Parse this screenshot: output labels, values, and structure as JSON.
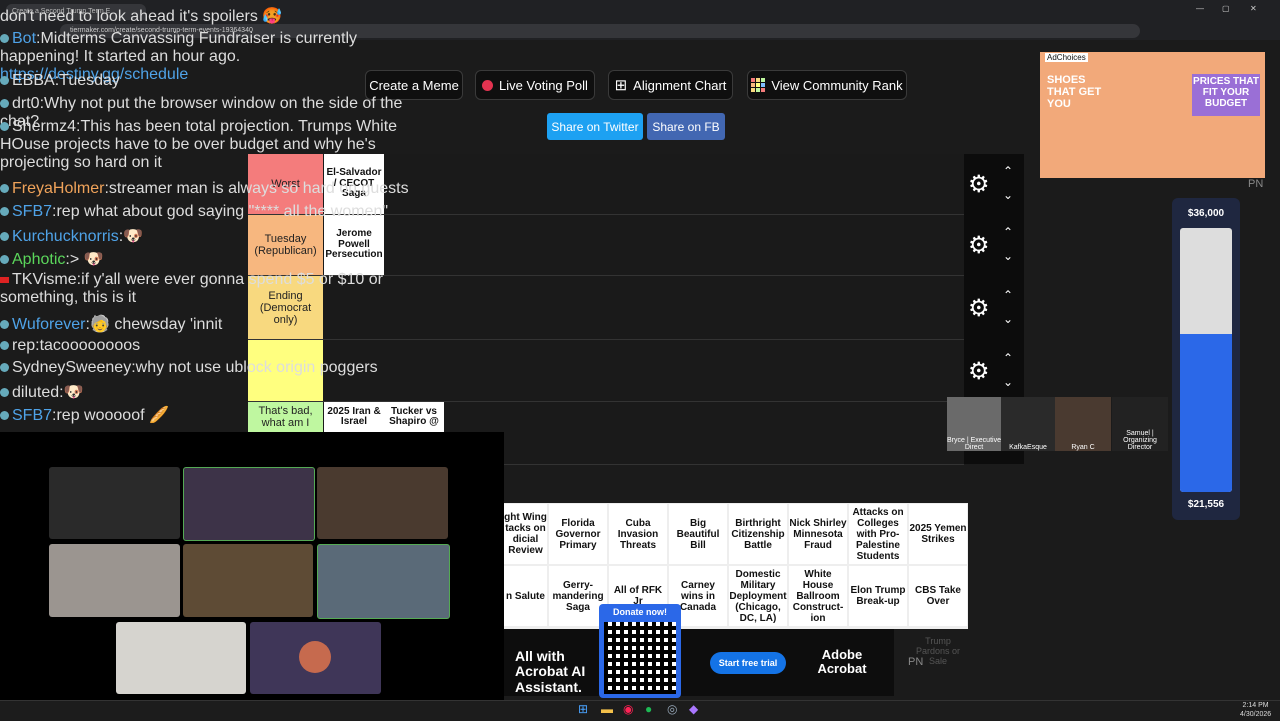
{
  "browser": {
    "tab_title": "Create a Second Trump Term E",
    "url": "tiermaker.com/create/second-trump-term-events-19364340"
  },
  "toolbar": {
    "create_meme": "Create a Meme",
    "live_voting": "Live Voting Poll",
    "alignment": "Alignment Chart",
    "community_rank": "View Community Rank",
    "share_twitter": "Share on Twitter",
    "share_fb": "Share on FB"
  },
  "tiers": [
    {
      "label": "Worst",
      "color": "#f47c7c"
    },
    {
      "label": "Tuesday (Republican)",
      "color": "#f7b77f"
    },
    {
      "label": "Ending (Democrat only)",
      "color": "#f8d97f"
    },
    {
      "label": "",
      "color": "#ffff7f"
    },
    {
      "label": "That's bad, what am I",
      "color": "#bff7a0"
    }
  ],
  "tier_cards": {
    "row1": [
      "El-Salvador / CECOT Saga"
    ],
    "row2": [
      "Jerome Powell Persecution"
    ],
    "row5": [
      "2025 Iran & Israel",
      "Tucker vs Shapiro @"
    ]
  },
  "pool": {
    "row1": [
      "ght Wing tacks on dicial Review",
      "Florida Governor Primary",
      "Cuba Invasion Threats",
      "Big Beautiful Bill",
      "Birthright Citizenship Battle",
      "Nick Shirley Minnesota Fraud",
      "Attacks on Colleges with Pro-Palestine Students",
      "2025 Yemen Strikes"
    ],
    "row2": [
      "n Salute",
      "Gerry-mandering Saga",
      "All of RFK Jr",
      "Carney wins in Canada",
      "Domestic Military Deployment (Chicago, DC, LA)",
      "White House Ballroom Construct-ion",
      "Elon Trump Break-up",
      "CBS Take Over"
    ],
    "extra": "Trump Pardons or Sale"
  },
  "chat": [
    {
      "user": "",
      "text": "don't need to look ahead it's spoilers 🥵",
      "color": "#ddd"
    },
    {
      "user": "Bot",
      "text": "Midterms Canvassing Fundraiser is currently happening! It started an hour ago.",
      "link": "https://destiny.gg/schedule",
      "color": "#4fa3e8"
    },
    {
      "user": "EBBA",
      "text": "Tuesday",
      "color": "#ddd"
    },
    {
      "user": "drt0",
      "text": "Why not put the browser window on the side of the chat?",
      "color": "#ddd"
    },
    {
      "user": "Shermz4",
      "text": "This has been total projection. Trumps White HOuse projects have to be over budget and why he's projecting so hard on it",
      "color": "#ddd"
    },
    {
      "user": "FreyaHolmer",
      "text": "streamer man is always so hard on guests",
      "color": "#f0a35a"
    },
    {
      "user": "SFB7",
      "text": "rep what about god saying \"**** all the women\"",
      "color": "#4fa3e8"
    },
    {
      "user": "Kurchucknorris",
      "text": "",
      "color": "#4fa3e8"
    },
    {
      "user": "Aphotic",
      "text": ">",
      "color": "#5bd65b"
    },
    {
      "user": "TKVisme",
      "text": "if y'all were ever gonna spend $5 or $10 or something, this is it",
      "color": "#ddd"
    },
    {
      "user": "Wuforever",
      "text": "chewsday 'innit",
      "color": "#4fa3e8"
    },
    {
      "user": "rep",
      "text": "tacoooooooos",
      "color": "#ddd"
    },
    {
      "user": "SydneySweeney",
      "text": "why not use ublock origin poggers",
      "color": "#ddd"
    },
    {
      "user": "diluted",
      "text": "",
      "color": "#ddd"
    },
    {
      "user": "SFB7",
      "text": "rep wooooof",
      "color": "#4fa3e8"
    }
  ],
  "ad_top": {
    "adchoices": "AdChoices",
    "shoes": "SHOES THAT GET YOU",
    "prices": "PRICES THAT FIT YOUR BUDGET"
  },
  "ad_bottom": {
    "headline": "All with Acrobat AI Assistant.",
    "cta": "Start free trial",
    "brand": "Adobe Acrobat"
  },
  "donation": {
    "top": "$36,000",
    "bottom": "$21,556",
    "fill_fraction": 0.6,
    "button": "Donate now!"
  },
  "participants": [
    {
      "name": "Bryce | Executive Direct"
    },
    {
      "name": "KafkaEsque"
    },
    {
      "name": "Ryan C"
    },
    {
      "name": "Samuel | Organizing Director"
    }
  ],
  "misc": {
    "pn1": "PN",
    "pn2": "PN"
  },
  "clock": {
    "time": "2:14 PM",
    "date": "4/30/2026"
  }
}
